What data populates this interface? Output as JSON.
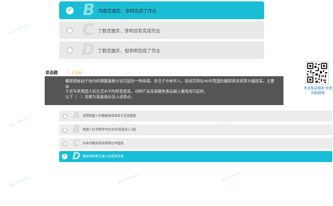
{
  "prev_question": {
    "options": [
      {
        "letter": "B",
        "text": "丙断定属实，李明完成了作业",
        "selected": true
      },
      {
        "letter": "C",
        "text": "丁断定属实，李明没有完成作业",
        "selected": false
      },
      {
        "letter": "D",
        "text": "丁断定属实，但李明完成了作业",
        "selected": false
      }
    ]
  },
  "question": {
    "type": "单选题",
    "score": "2.5分",
    "stem": [
      "糖尿病是由于体内的胰腺激素分泌引起的一种疾病。多见于中老年人。有研究称在40年我国的糖尿病发病率大幅提高。主要由",
      "于近年来我国人民生活水平的明显提高，动物产品及高糖类食品摄入量增加引起的。",
      "以下（　）如果为真最能反驳上述观点。"
    ],
    "options": [
      {
        "letter": "A",
        "text": "说明我国人的胰腺发病率高于其他国家",
        "selected": false
      },
      {
        "letter": "B",
        "text": "我国人均消费年中近40年来提高1.2倍",
        "selected": false
      },
      {
        "letter": "C",
        "text": "日本的糖尿病发病率比中国低",
        "selected": false
      },
      {
        "letter": "D",
        "text": "糖尿病病率与收入的提高无关",
        "selected": true
      }
    ]
  },
  "side": {
    "qr_caption": "专业笔试题库 长按扫码获取"
  },
  "watermark": "WLC Aimyou"
}
